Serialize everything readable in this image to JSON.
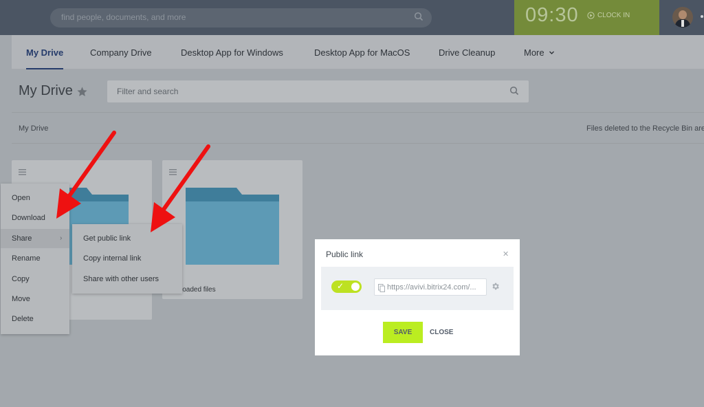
{
  "topbar": {
    "search_placeholder": "find people, documents, and more",
    "clock_time": "09:30",
    "clock_in_label": "CLOCK IN"
  },
  "tabs": [
    {
      "label": "My Drive",
      "active": true
    },
    {
      "label": "Company Drive"
    },
    {
      "label": "Desktop App for Windows"
    },
    {
      "label": "Desktop App for MacOS"
    },
    {
      "label": "Drive Cleanup"
    },
    {
      "label": "More"
    }
  ],
  "page": {
    "title": "My Drive",
    "filter_placeholder": "Filter and search",
    "breadcrumb": "My Drive",
    "notice": "Files deleted to the Recycle Bin are"
  },
  "cards": [
    {
      "name": ""
    },
    {
      "name": "loaded files"
    }
  ],
  "context_menu": {
    "items": [
      "Open",
      "Download",
      "Share",
      "Rename",
      "Copy",
      "Move",
      "Delete"
    ]
  },
  "share_submenu": {
    "items": [
      "Get public link",
      "Copy internal link",
      "Share with other users"
    ]
  },
  "modal": {
    "title": "Public link",
    "url": "https://avivi.bitrix24.com/...",
    "toggle_on": true,
    "save_label": "SAVE",
    "close_label": "CLOSE"
  },
  "colors": {
    "accent_green": "#bbed21",
    "arrow_red": "#ee1111",
    "active_tab": "#263c6b"
  }
}
